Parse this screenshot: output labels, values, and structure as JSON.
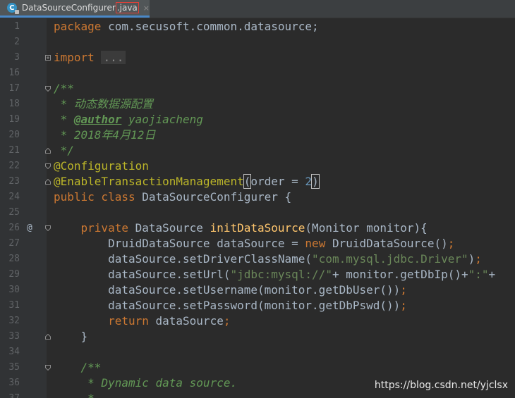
{
  "tab": {
    "icon_letter": "C",
    "file_name": "DataSourceConfigurer",
    "file_ext": ".java",
    "close_glyph": "×"
  },
  "gutter": {
    "override_marker": "@"
  },
  "lines": [
    {
      "n": "1",
      "tokens": [
        [
          "kw",
          "package "
        ],
        [
          "plain",
          "com.secusoft.common.datasource;"
        ]
      ]
    },
    {
      "n": "2",
      "tokens": []
    },
    {
      "n": "3",
      "fold": "plus",
      "tokens": [
        [
          "kw",
          "import "
        ],
        [
          "fold-ph",
          "..."
        ]
      ]
    },
    {
      "n": "16",
      "tokens": []
    },
    {
      "n": "17",
      "fold": "open",
      "tokens": [
        [
          "doc",
          "/**"
        ]
      ]
    },
    {
      "n": "18",
      "tokens": [
        [
          "doc",
          " * 动态数据源配置"
        ]
      ]
    },
    {
      "n": "19",
      "tokens": [
        [
          "doc",
          " * "
        ],
        [
          "doctag",
          "@author"
        ],
        [
          "doc",
          " yaojiacheng"
        ]
      ]
    },
    {
      "n": "20",
      "tokens": [
        [
          "doc",
          " * 2018年4月12日"
        ]
      ]
    },
    {
      "n": "21",
      "fold": "close",
      "tokens": [
        [
          "doc",
          " */"
        ]
      ]
    },
    {
      "n": "22",
      "fold": "open",
      "tokens": [
        [
          "ann",
          "@Configuration"
        ]
      ]
    },
    {
      "n": "23",
      "fold": "close",
      "tokens": [
        [
          "ann",
          "@EnableTransactionManagement"
        ],
        [
          "hl",
          "("
        ],
        [
          "plain",
          "order = "
        ],
        [
          "num",
          "2"
        ],
        [
          "hl",
          ")"
        ]
      ]
    },
    {
      "n": "24",
      "tokens": [
        [
          "kw",
          "public class "
        ],
        [
          "plain",
          "DataSourceConfigurer {"
        ]
      ]
    },
    {
      "n": "25",
      "tokens": []
    },
    {
      "n": "26",
      "marker": true,
      "fold": "open",
      "tokens": [
        [
          "plain",
          "    "
        ],
        [
          "kw",
          "private "
        ],
        [
          "plain",
          "DataSource "
        ],
        [
          "meth",
          "initDataSource"
        ],
        [
          "plain",
          "(Monitor monitor){"
        ]
      ]
    },
    {
      "n": "27",
      "tokens": [
        [
          "plain",
          "        DruidDataSource dataSource = "
        ],
        [
          "kw",
          "new "
        ],
        [
          "plain",
          "DruidDataSource()"
        ],
        [
          "kw",
          ";"
        ]
      ]
    },
    {
      "n": "28",
      "tokens": [
        [
          "plain",
          "        dataSource.setDriverClassName("
        ],
        [
          "str",
          "\"com.mysql.jdbc.Driver\""
        ],
        [
          "plain",
          ")"
        ],
        [
          "kw",
          ";"
        ]
      ]
    },
    {
      "n": "29",
      "tokens": [
        [
          "plain",
          "        dataSource.setUrl("
        ],
        [
          "str",
          "\"jdbc:mysql://\""
        ],
        [
          "plain",
          "+ monitor.getDbIp()+"
        ],
        [
          "str",
          "\":\""
        ],
        [
          "plain",
          "+"
        ]
      ]
    },
    {
      "n": "30",
      "tokens": [
        [
          "plain",
          "        dataSource.setUsername(monitor.getDbUser())"
        ],
        [
          "kw",
          ";"
        ]
      ]
    },
    {
      "n": "31",
      "tokens": [
        [
          "plain",
          "        dataSource.setPassword(monitor.getDbPswd())"
        ],
        [
          "kw",
          ";"
        ]
      ]
    },
    {
      "n": "32",
      "tokens": [
        [
          "plain",
          "        "
        ],
        [
          "kw",
          "return "
        ],
        [
          "plain",
          "dataSource"
        ],
        [
          "kw",
          ";"
        ]
      ]
    },
    {
      "n": "33",
      "fold": "close",
      "tokens": [
        [
          "plain",
          "    }"
        ]
      ]
    },
    {
      "n": "34",
      "tokens": []
    },
    {
      "n": "35",
      "fold": "open",
      "tokens": [
        [
          "plain",
          "    "
        ],
        [
          "doc",
          "/**"
        ]
      ]
    },
    {
      "n": "36",
      "tokens": [
        [
          "plain",
          "     "
        ],
        [
          "doc",
          "* Dynamic data source."
        ]
      ]
    },
    {
      "n": "37",
      "tokens": [
        [
          "plain",
          "     "
        ],
        [
          "doc",
          "*"
        ]
      ]
    }
  ],
  "watermark": "https://blog.csdn.net/yjclsx"
}
